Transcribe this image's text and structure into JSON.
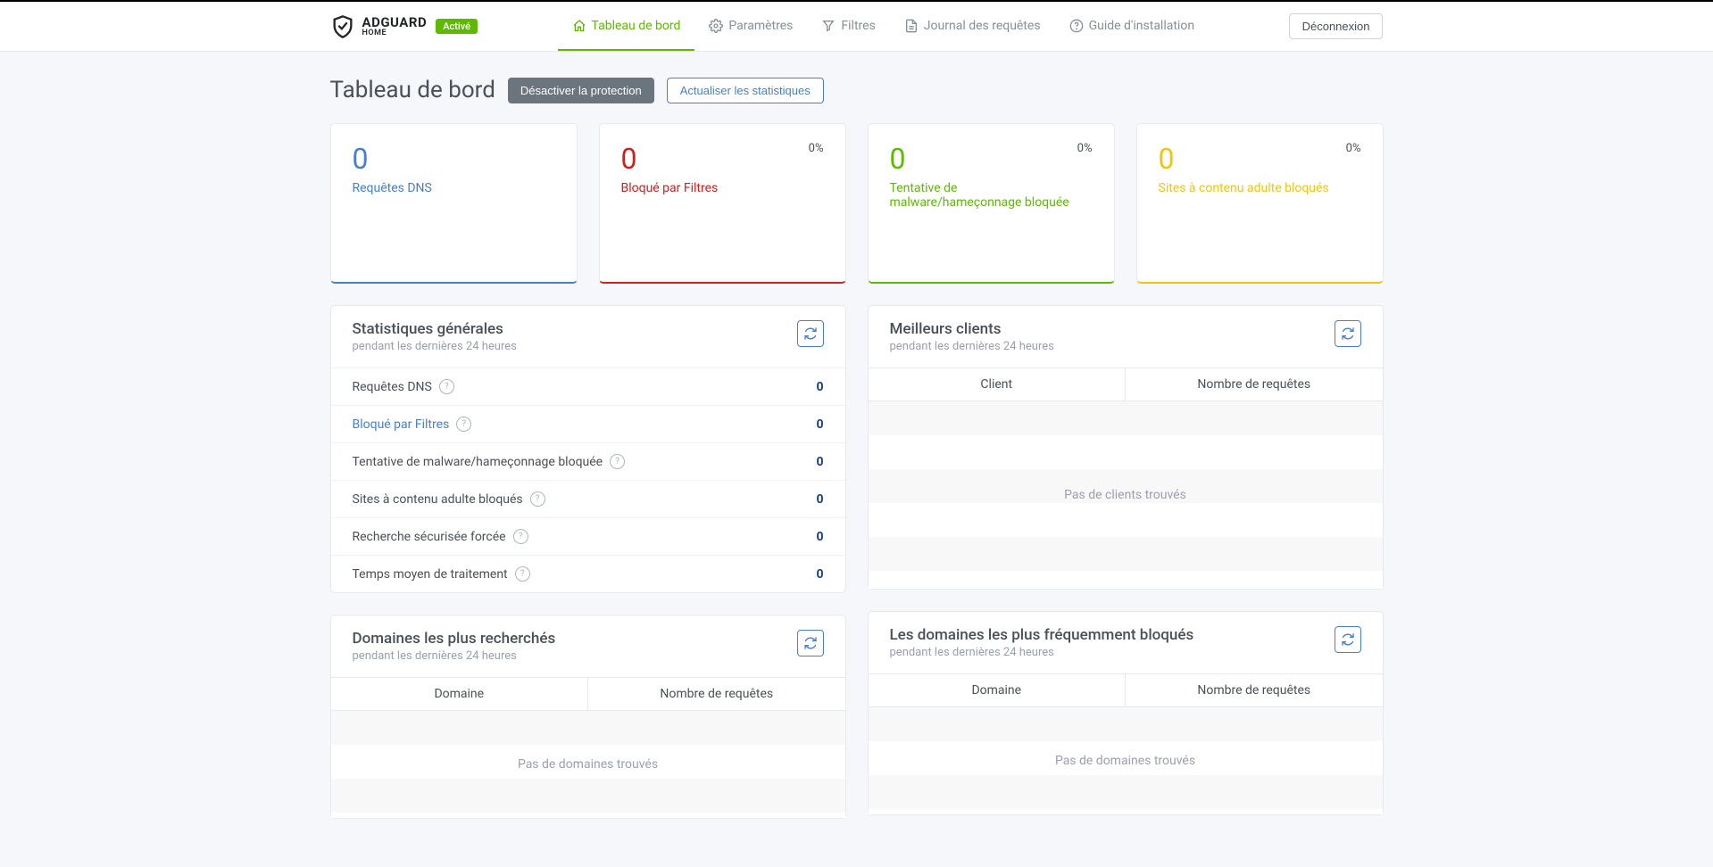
{
  "logo": {
    "brand": "ADGUARD",
    "sub": "HOME",
    "status": "Activé"
  },
  "nav": {
    "dashboard": "Tableau de bord",
    "settings": "Paramètres",
    "filters": "Filtres",
    "querylog": "Journal des requêtes",
    "guide": "Guide d'installation"
  },
  "logout": "Déconnexion",
  "page": {
    "title": "Tableau de bord",
    "disable": "Désactiver la protection",
    "refresh": "Actualiser les statistiques"
  },
  "stats": {
    "dns": {
      "value": "0",
      "label": "Requêtes DNS"
    },
    "blocked": {
      "value": "0",
      "label": "Bloqué par Filtres",
      "pct": "0%"
    },
    "malware": {
      "value": "0",
      "label": "Tentative de malware/hameçonnage bloquée",
      "pct": "0%"
    },
    "adult": {
      "value": "0",
      "label": "Sites à contenu adulte bloqués",
      "pct": "0%"
    }
  },
  "general": {
    "title": "Statistiques générales",
    "sub": "pendant les dernières 24 heures",
    "rows": {
      "dns": {
        "label": "Requêtes DNS",
        "value": "0"
      },
      "blocked": {
        "label": "Bloqué par Filtres",
        "value": "0"
      },
      "malware": {
        "label": "Tentative de malware/hameçonnage bloquée",
        "value": "0"
      },
      "adult": {
        "label": "Sites à contenu adulte bloqués",
        "value": "0"
      },
      "safesearch": {
        "label": "Recherche sécurisée forcée",
        "value": "0"
      },
      "avg": {
        "label": "Temps moyen de traitement",
        "value": "0"
      }
    }
  },
  "clients": {
    "title": "Meilleurs clients",
    "sub": "pendant les dernières 24 heures",
    "col1": "Client",
    "col2": "Nombre de requêtes",
    "empty": "Pas de clients trouvés"
  },
  "queried": {
    "title": "Domaines les plus recherchés",
    "sub": "pendant les dernières 24 heures",
    "col1": "Domaine",
    "col2": "Nombre de requêtes",
    "empty": "Pas de domaines trouvés"
  },
  "blockedDom": {
    "title": "Les domaines les plus fréquemment bloqués",
    "sub": "pendant les dernières 24 heures",
    "col1": "Domaine",
    "col2": "Nombre de requêtes",
    "empty": "Pas de domaines trouvés"
  }
}
